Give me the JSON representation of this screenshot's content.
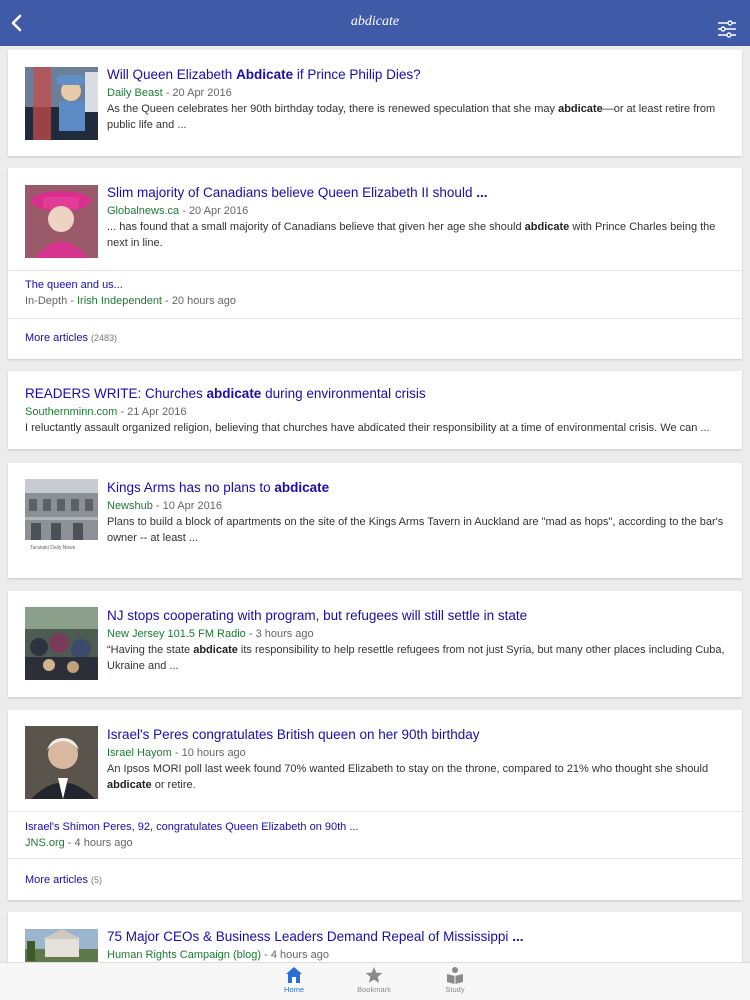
{
  "header": {
    "title": "abdicate"
  },
  "cards": [
    {
      "headline_pre": "Will Queen Elizabeth ",
      "headline_bold": "Abdicate",
      "headline_post": " if Prince Philip Dies?",
      "source": "Daily Beast",
      "date": "20 Apr 2016",
      "snippet_pre": "As the Queen celebrates her 90th birthday today, there is renewed speculation that she may ",
      "snippet_bold": "abdicate",
      "snippet_post": "—or at least retire from public life and ..."
    },
    {
      "headline_pre": "Slim majority of Canadians believe Queen Elizabeth II should ",
      "headline_bold": "...",
      "headline_post": "",
      "source": "Globalnews.ca",
      "date": "20 Apr 2016",
      "snippet_pre": "... has found that a small majority of Canadians believe that given her age she should ",
      "snippet_bold": "abdicate",
      "snippet_post": " with Prince Charles being the next in line.",
      "related": {
        "headline": "The queen and us...",
        "prefix": "In-Depth",
        "source": "Irish Independent",
        "date": "20 hours ago"
      },
      "more_label": "More articles",
      "more_count": "(2483)"
    },
    {
      "headline_pre": "READERS WRITE: Churches ",
      "headline_bold": "abdicate",
      "headline_post": " during environmental crisis",
      "source": "Southernminn.com",
      "date": "21 Apr 2016",
      "snippet_pre": "I reluctantly assault organized religion, believing that churches have abdicated their responsibility at a time of environmental crisis. We can ...",
      "snippet_bold": "",
      "snippet_post": ""
    },
    {
      "headline_pre": "Kings Arms has no plans to ",
      "headline_bold": "abdicate",
      "headline_post": "",
      "source": "Newshub",
      "date": "10 Apr 2016",
      "snippet_pre": "Plans to build a block of apartments on the site of the Kings Arms Tavern in Auckland are \"mad as hops\", according to the bar's owner -- at least ...",
      "snippet_bold": "",
      "snippet_post": "",
      "thumb_caption": "Taranaki Daily News"
    },
    {
      "headline_pre": "NJ stops cooperating with program, but refugees will still settle in state",
      "headline_bold": "",
      "headline_post": "",
      "source": "New Jersey 101.5 FM Radio",
      "date": "3 hours ago",
      "snippet_pre": "“Having the state ",
      "snippet_bold": "abdicate",
      "snippet_post": " its responsibility to help resettle refugees from not just Syria, but many other places including Cuba, Ukraine and ..."
    },
    {
      "headline_pre": "Israel's Peres congratulates British queen on her 90th birthday",
      "headline_bold": "",
      "headline_post": "",
      "source": "Israel Hayom",
      "date": "10 hours ago",
      "snippet_pre": "An Ipsos MORI poll last week found 70% wanted Elizabeth to stay on the throne, compared to 21% who thought she should ",
      "snippet_bold": "abdicate",
      "snippet_post": " or retire.",
      "related": {
        "headline": "Israel's Shimon Peres, 92, congratulates Queen Elizabeth on 90th ...",
        "prefix": "",
        "source": "JNS.org",
        "date": "4 hours ago"
      },
      "more_label": "More articles",
      "more_count": "(5)"
    },
    {
      "headline_pre": "75 Major CEOs & Business Leaders Demand Repeal of Mississippi ",
      "headline_bold": "...",
      "headline_post": "",
      "source": "Human Rights Campaign (blog)",
      "date": "4 hours ago"
    }
  ],
  "tabs": [
    {
      "label": "Home",
      "icon": "home-icon",
      "active": true
    },
    {
      "label": "Bookmark",
      "icon": "star-icon",
      "active": false
    },
    {
      "label": "Study",
      "icon": "study-icon",
      "active": false
    }
  ],
  "colors": {
    "header": "#3f5aa6",
    "link": "#1a0dab",
    "source": "#1e7b34",
    "tab_active": "#2b6fd6",
    "tab_inactive": "#8a8a8a"
  }
}
